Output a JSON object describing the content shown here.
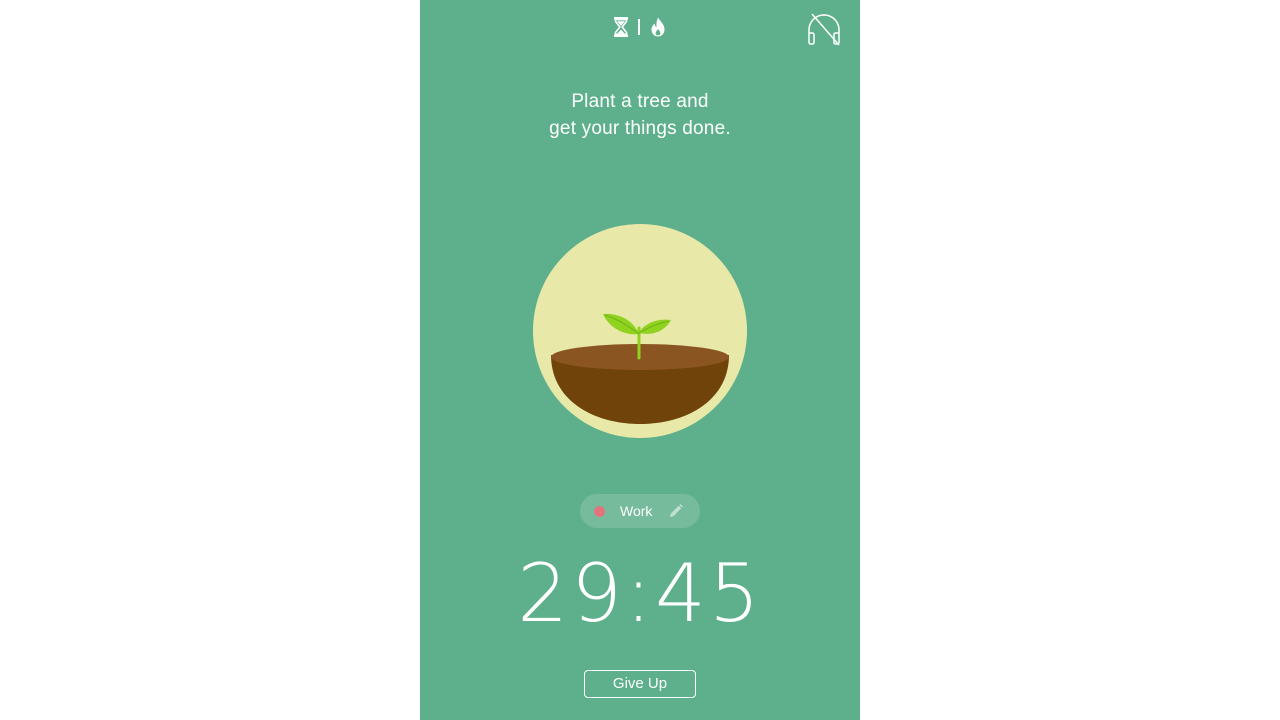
{
  "app": {
    "background_color": "#5db08b",
    "accent_color": "#ffffff"
  },
  "topbar": {
    "mode_icons": [
      "hourglass-icon",
      "flame-icon"
    ],
    "music_icon": "headphones-off-icon"
  },
  "motto": {
    "line1": "Plant a tree and",
    "line2": "get your things done."
  },
  "tree": {
    "stage": "sprout",
    "circle_color": "#e8e8a9",
    "soil_color": "#6f4309",
    "leaf_color": "#8fd21f"
  },
  "tag": {
    "label": "Work",
    "dot_color": "#e2747d",
    "edit_icon": "pencil-icon"
  },
  "timer": {
    "minutes": "29",
    "separator": ":",
    "seconds": "45"
  },
  "actions": {
    "give_up_label": "Give Up"
  }
}
